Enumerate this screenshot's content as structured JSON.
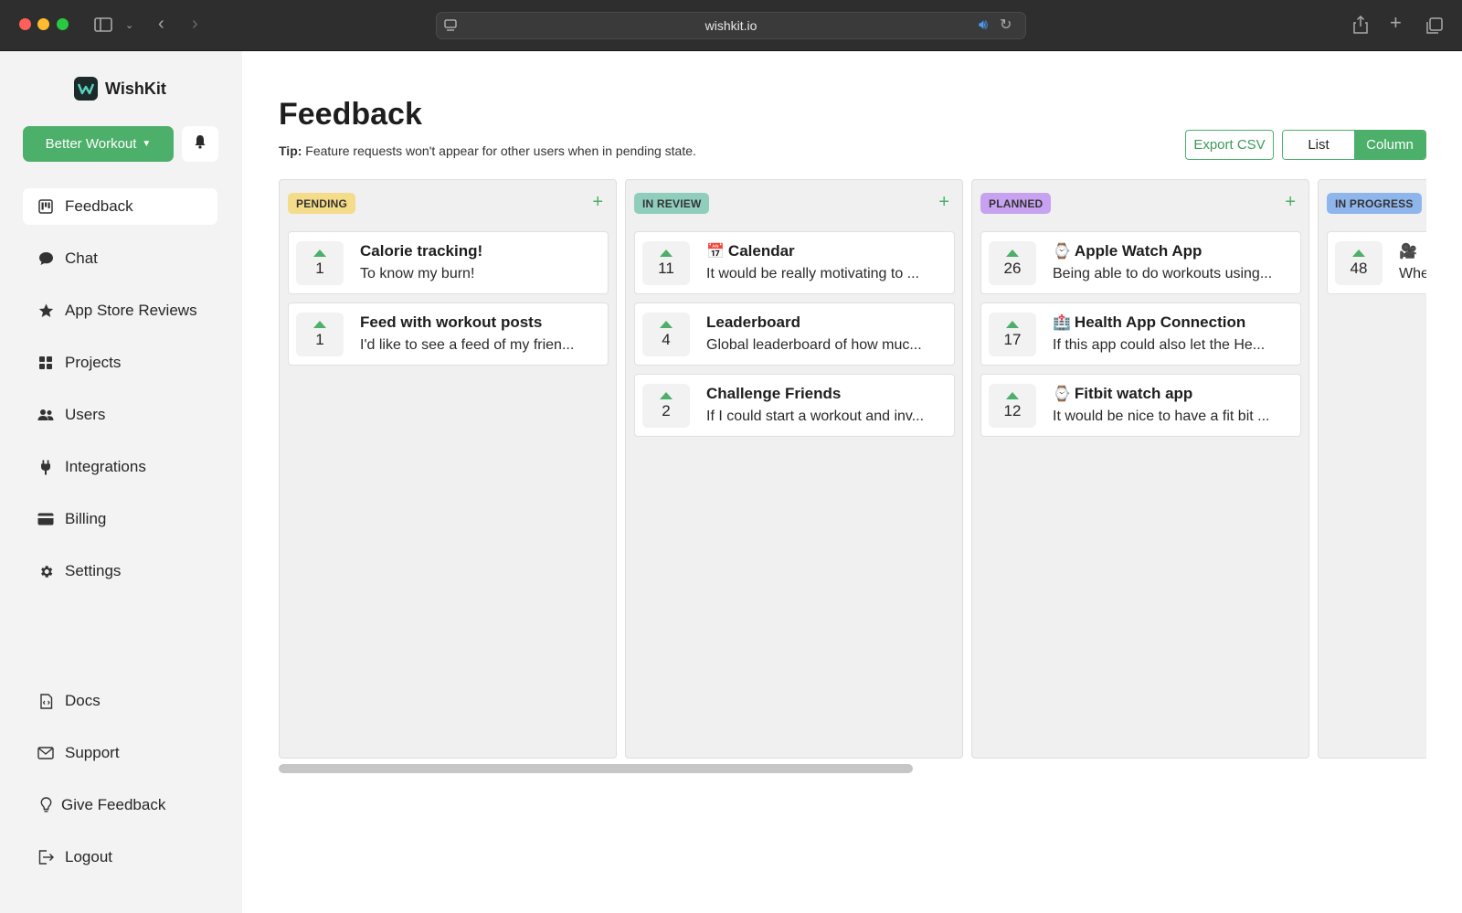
{
  "browser": {
    "url": "wishkit.io"
  },
  "sidebar": {
    "app_name": "WishKit",
    "project_selector": "Better Workout",
    "nav": [
      {
        "label": "Feedback",
        "icon": "kanban-icon"
      },
      {
        "label": "Chat",
        "icon": "chat-bubble-icon"
      },
      {
        "label": "App Store Reviews",
        "icon": "star-icon"
      },
      {
        "label": "Projects",
        "icon": "grid-icon"
      },
      {
        "label": "Users",
        "icon": "users-icon"
      },
      {
        "label": "Integrations",
        "icon": "plug-icon"
      },
      {
        "label": "Billing",
        "icon": "credit-card-icon"
      },
      {
        "label": "Settings",
        "icon": "gear-icon"
      }
    ],
    "footer_nav": [
      {
        "label": "Docs",
        "icon": "docs-icon"
      },
      {
        "label": "Support",
        "icon": "envelope-icon"
      },
      {
        "label": "Give Feedback",
        "icon": "lightbulb-icon"
      },
      {
        "label": "Logout",
        "icon": "logout-icon"
      }
    ]
  },
  "main": {
    "title": "Feedback",
    "tip_label": "Tip:",
    "tip_text": "Feature requests won't appear for other users when in pending state.",
    "export_label": "Export CSV",
    "view_list": "List",
    "view_column": "Column"
  },
  "columns": [
    {
      "status": "PENDING",
      "color": "#f5dc8a",
      "cards": [
        {
          "votes": "1",
          "emoji": "",
          "title": "Calorie tracking!",
          "desc": "To know my burn!"
        },
        {
          "votes": "1",
          "emoji": "",
          "title": "Feed with workout posts",
          "desc": "I'd like to see a feed of my frien..."
        }
      ]
    },
    {
      "status": "IN REVIEW",
      "color": "#8fcdbd",
      "cards": [
        {
          "votes": "11",
          "emoji": "📅",
          "title": "Calendar",
          "desc": "It would be really motivating to ..."
        },
        {
          "votes": "4",
          "emoji": "",
          "title": "Leaderboard",
          "desc": "Global leaderboard of how muc..."
        },
        {
          "votes": "2",
          "emoji": "",
          "title": "Challenge Friends",
          "desc": "If I could start a workout and inv..."
        }
      ]
    },
    {
      "status": "PLANNED",
      "color": "#c7a2f0",
      "cards": [
        {
          "votes": "26",
          "emoji": "⌚",
          "title": "Apple Watch App",
          "desc": "Being able to do workouts using..."
        },
        {
          "votes": "17",
          "emoji": "🏥",
          "title": "Health App Connection",
          "desc": "If this app could also let the He..."
        },
        {
          "votes": "12",
          "emoji": "⌚",
          "title": "Fitbit watch app",
          "desc": "It would be nice to have a fit bit ..."
        }
      ]
    },
    {
      "status": "IN PROGRESS",
      "color": "#8fb6ec",
      "cards": [
        {
          "votes": "48",
          "emoji": "🎥",
          "title": "",
          "desc": "Whe"
        }
      ]
    }
  ]
}
